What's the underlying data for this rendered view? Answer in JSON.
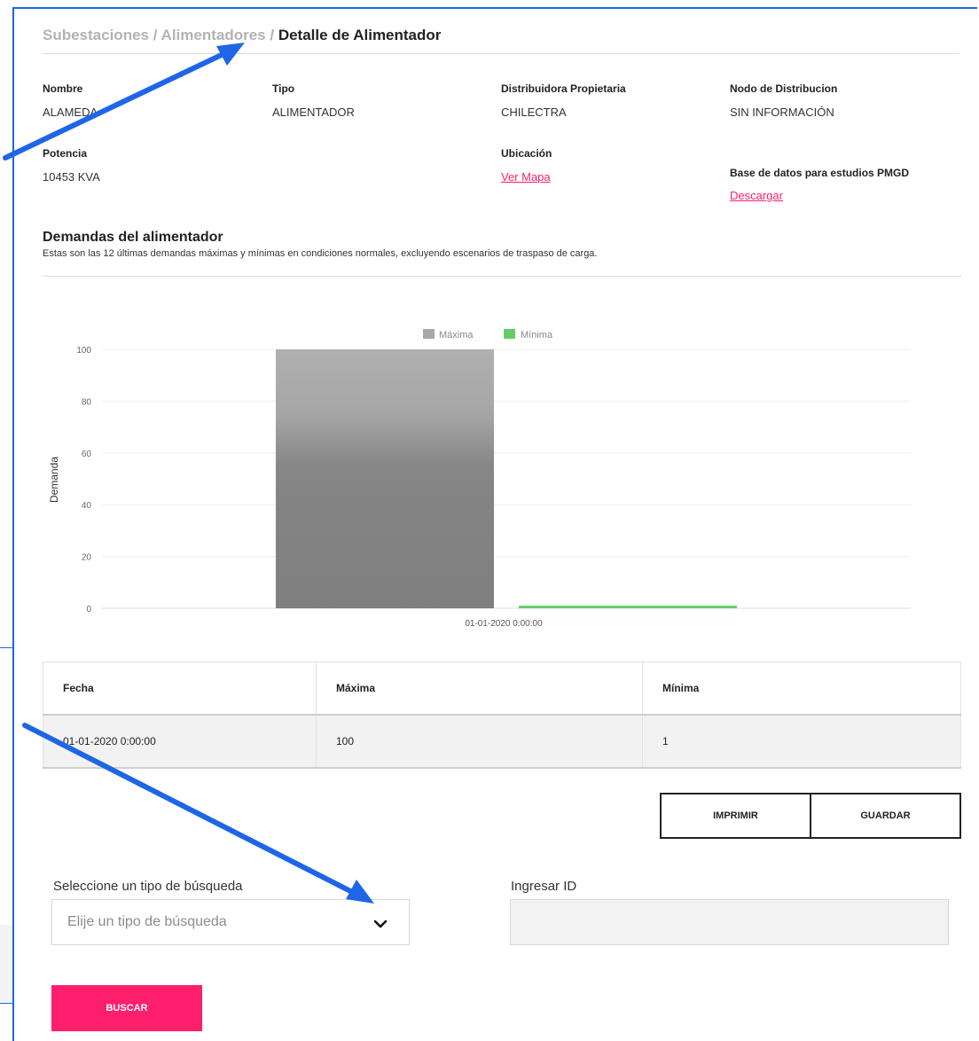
{
  "breadcrumb": {
    "level1": "Subestaciones",
    "sep1": " / ",
    "level2": "Alimentadores",
    "sep2": " / ",
    "current": "Detalle de Alimentador"
  },
  "details": {
    "nombre": {
      "label": "Nombre",
      "value": "ALAMEDA"
    },
    "tipo": {
      "label": "Tipo",
      "value": "ALIMENTADOR"
    },
    "distribuidora": {
      "label": "Distribuidora Propietaria",
      "value": "CHILECTRA"
    },
    "nodo": {
      "label": "Nodo de Distribucion",
      "value": "SIN INFORMACIÓN"
    },
    "potencia": {
      "label": "Potencia",
      "value": "10453 KVA"
    },
    "ubicacion": {
      "label": "Ubicación",
      "link": "Ver Mapa"
    },
    "base_datos": {
      "label": "Base de datos para estudios PMGD",
      "link": "Descargar"
    }
  },
  "demandas": {
    "title": "Demandas del alimentador",
    "description": "Estas son las 12 últimas demandas máximas y mínimas en condiciones normales, excluyendo escenarios de traspaso de carga."
  },
  "chart_data": {
    "type": "bar",
    "categories": [
      "01-01-2020 0:00:00"
    ],
    "series": [
      {
        "name": "Máxima",
        "values": [
          100
        ],
        "color": "#8a8a8a"
      },
      {
        "name": "Mínima",
        "values": [
          1
        ],
        "color": "#66cc66"
      }
    ],
    "ylabel": "Demanda",
    "xlabel": "",
    "ylim": [
      0,
      100
    ],
    "yticks": [
      0,
      20,
      40,
      60,
      80,
      100
    ],
    "grid": true,
    "legend": "top-center"
  },
  "table": {
    "headers": [
      "Fecha",
      "Máxima",
      "Mínima"
    ],
    "rows": [
      [
        "01-01-2020 0:00:00",
        "100",
        "1"
      ]
    ]
  },
  "actions": {
    "print": "IMPRIMIR",
    "save": "GUARDAR"
  },
  "search": {
    "type_label": "Seleccione un tipo de búsqueda",
    "type_placeholder": "Elije un tipo de búsqueda",
    "id_label": "Ingresar ID",
    "submit": "BUSCAR"
  },
  "colors": {
    "accent": "#ff1f6d",
    "annotation": "#1e66e6"
  },
  "icons": {
    "select": "chevron-down-icon"
  }
}
